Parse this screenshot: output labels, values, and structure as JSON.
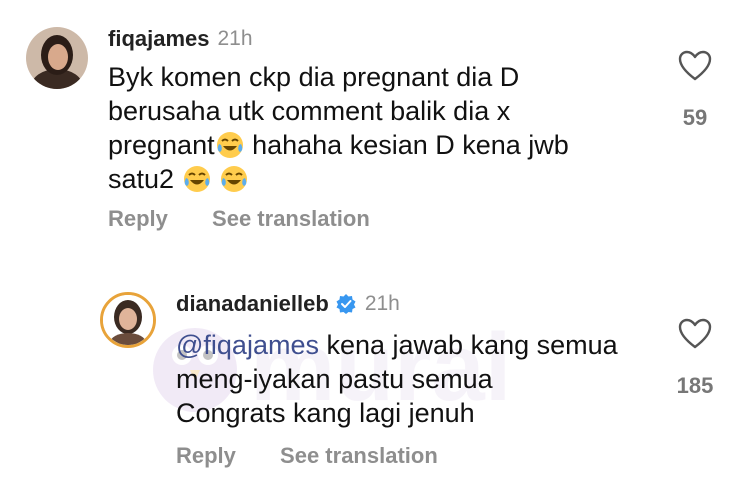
{
  "comments": [
    {
      "username": "fiqajames",
      "time": "21h",
      "text_line1": "Byk komen ckp dia pregnant dia D",
      "text_line2": "berusaha utk comment balik dia x",
      "text_line3a": "pregnant",
      "text_line3b": " hahaha kesian D kena jwb",
      "text_line4": "satu2",
      "like_count": "59",
      "reply_label": "Reply",
      "translate_label": "See translation"
    },
    {
      "username": "dianadanielleb",
      "time": "21h",
      "mention": "@fiqajames",
      "text_line1": " kena jawab kang semua",
      "text_line2": "meng-iyakan pastu semua",
      "text_line3": "Congrats kang lagi jenuh",
      "like_count": "185",
      "reply_label": "Reply",
      "translate_label": "See translation"
    }
  ],
  "watermark_text": "murai",
  "colors": {
    "mention": "#3f4f8f",
    "verified": "#3897f0",
    "muted": "#8e8e8e"
  },
  "icons": [
    "heart-outline-icon",
    "verified-badge-icon",
    "laughing-tears-emoji"
  ]
}
